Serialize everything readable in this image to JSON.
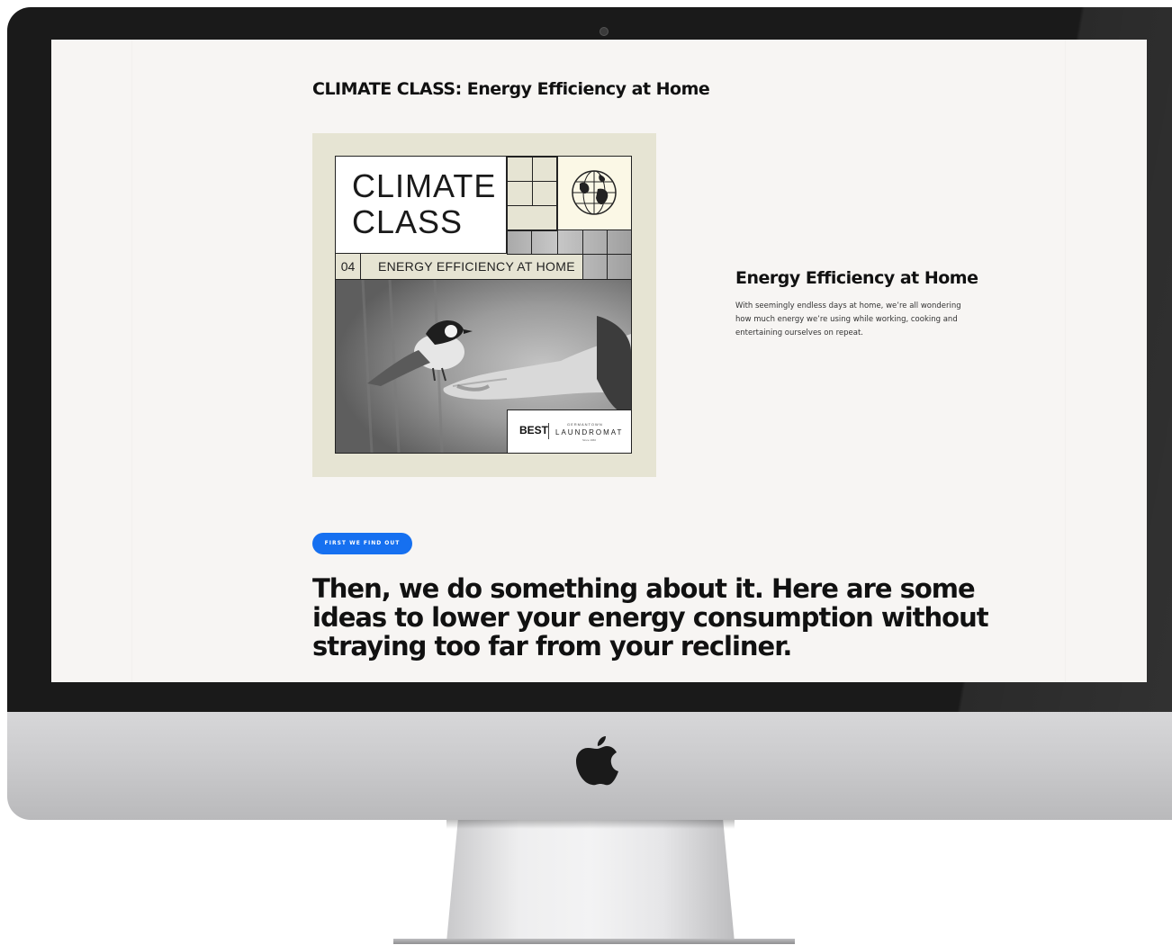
{
  "page": {
    "title": "CLIMATE CLASS: Energy Efficiency at Home"
  },
  "poster": {
    "title_line1": "CLIMATE",
    "title_line2": "CLASS",
    "episode_number": "04",
    "episode_title": "ENERGY EFFICIENCY AT HOME",
    "badge_best": "BEST",
    "badge_small": "GERMANTOWN",
    "badge_name": "LAUNDROMAT",
    "badge_since": "Since 1960",
    "icon": "globe-icon",
    "background_color": "#e6e4d3"
  },
  "feature": {
    "heading": "Energy Efficiency at Home",
    "body": "With seemingly endless days at home, we’re all wondering how much energy we’re using while working, cooking and entertaining ourselves on repeat."
  },
  "cta": {
    "label": "FIRST WE FIND OUT",
    "color": "#1670f0"
  },
  "section": {
    "heading": "Then, we do something about it. Here are some ideas to lower your energy consumption without straying too far from your recliner."
  },
  "device": {
    "logo_icon": "apple-logo-icon"
  }
}
